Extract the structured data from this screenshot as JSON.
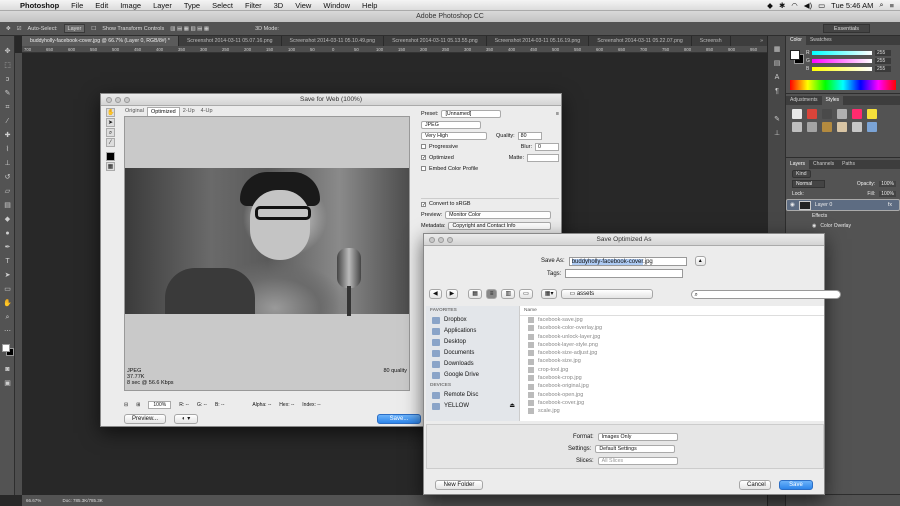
{
  "menubar": {
    "apple": "",
    "app": "Photoshop",
    "items": [
      "File",
      "Edit",
      "Image",
      "Layer",
      "Type",
      "Select",
      "Filter",
      "3D",
      "View",
      "Window",
      "Help"
    ],
    "right": {
      "battery": "",
      "time": "Tue 5:46 AM"
    }
  },
  "window_title": "Adobe Photoshop CC",
  "optionsbar": {
    "auto_select": "Auto-Select:",
    "layer": "Layer",
    "show_transform": "Show Transform Controls",
    "mode_3d": "3D Mode:",
    "workspace": "Essentials"
  },
  "doc_tabs": [
    "buddyholly-facebook-cover.jpg @ 66.7% (Layer 0, RGB/8#) *",
    "Screenshot 2014-03-11 05.07.16.png",
    "Screenshot 2014-03-11 05.10.49.png",
    "Screenshot 2014-03-11 05.13.55.png",
    "Screenshot 2014-03-11 05.16.19.png",
    "Screenshot 2014-03-11 05.22.07.png",
    "Screensh"
  ],
  "ruler": [
    "700",
    "650",
    "600",
    "550",
    "500",
    "450",
    "400",
    "350",
    "300",
    "250",
    "200",
    "150",
    "100",
    "50",
    "0",
    "50",
    "100",
    "150",
    "200",
    "250",
    "300",
    "350",
    "400",
    "450",
    "500",
    "550",
    "600",
    "650",
    "700",
    "750",
    "800",
    "850",
    "900",
    "950"
  ],
  "status": {
    "zoom": "66.67%",
    "doc": "Doc: 785.3K/785.3K"
  },
  "panels": {
    "color_tabs": [
      "Color",
      "Swatches"
    ],
    "color_values": [
      "255",
      "255",
      "255"
    ],
    "adjust_tabs": [
      "Adjustments",
      "Styles"
    ],
    "layers_tabs": [
      "Layers",
      "Channels",
      "Paths"
    ],
    "kind": "Kind",
    "blend": "Normal",
    "opacity_label": "Opacity:",
    "opacity": "100%",
    "lock": "Lock:",
    "fill_label": "Fill:",
    "fill": "100%",
    "layers": [
      {
        "name": "Layer 0",
        "fx": "fx"
      },
      {
        "name": "Effects"
      },
      {
        "name": "Color Overlay"
      }
    ],
    "style_colors": [
      "#e8e8e8",
      "#d9443a",
      "#4a4a4a",
      "#b0b0b0",
      "#ff2a6e",
      "#f6e13b",
      "#bfbfbf",
      "#a4a4a4",
      "#b38a3f",
      "#d9c5a4",
      "#c7c7c7",
      "#7ba4d6"
    ]
  },
  "sfw": {
    "title": "Save for Web (100%)",
    "tabs": [
      "Original",
      "Optimized",
      "2-Up",
      "4-Up"
    ],
    "info": {
      "format": "JPEG",
      "size": "37.77K",
      "time": "8 sec @ 56.6 Kbps",
      "quality": "80 quality"
    },
    "zoom": "100%",
    "readout": [
      "R: --",
      "G: --",
      "B: --",
      "Alpha: --",
      "Hex: --",
      "Index: --"
    ],
    "preview_btn": "Preview...",
    "save_btn": "Save...",
    "preset_label": "Preset:",
    "preset": "[Unnamed]",
    "format": "JPEG",
    "quality_name": "Very High",
    "quality_label": "Quality:",
    "quality_val": "80",
    "progressive": "Progressive",
    "blur_label": "Blur:",
    "blur_val": "0",
    "optimized": "Optimized",
    "matte_label": "Matte:",
    "embed": "Embed Color Profile",
    "convert": "Convert to sRGB",
    "preview_label": "Preview:",
    "preview_val": "Monitor Color",
    "metadata_label": "Metadata:",
    "metadata_val": "Copyright and Contact Info"
  },
  "savedlg": {
    "title": "Save Optimized As",
    "save_as_label": "Save As:",
    "save_as_name": "buddyholly-facebook-cover",
    ".ext": ".jpg",
    "tags_label": "Tags:",
    "folder": "assets",
    "favorites_hd": "FAVORITES",
    "favorites": [
      "Dropbox",
      "Applications",
      "Desktop",
      "Documents",
      "Downloads",
      "Google Drive"
    ],
    "devices_hd": "DEVICES",
    "devices": [
      "Remote Disc",
      "YELLOW"
    ],
    "name_col": "Name",
    "files": [
      "facebook-save.jpg",
      "facebook-color-overlay.jpg",
      "facebook-unlock-layer.jpg",
      "facebook-layer-style.png",
      "facebook-size-adjust.jpg",
      "facebook-size.jpg",
      "crop-tool.jpg",
      "facebook-crop.jpg",
      "facebook-original.jpg",
      "facebook-open.jpg",
      "facebook-cover.jpg",
      "scale.jpg"
    ],
    "format_label": "Format:",
    "format_val": "Images Only",
    "settings_label": "Settings:",
    "settings_val": "Default Settings",
    "slices_label": "Slices:",
    "slices_val": "All Slices",
    "new_folder": "New Folder",
    "cancel": "Cancel",
    "save": "Save"
  }
}
